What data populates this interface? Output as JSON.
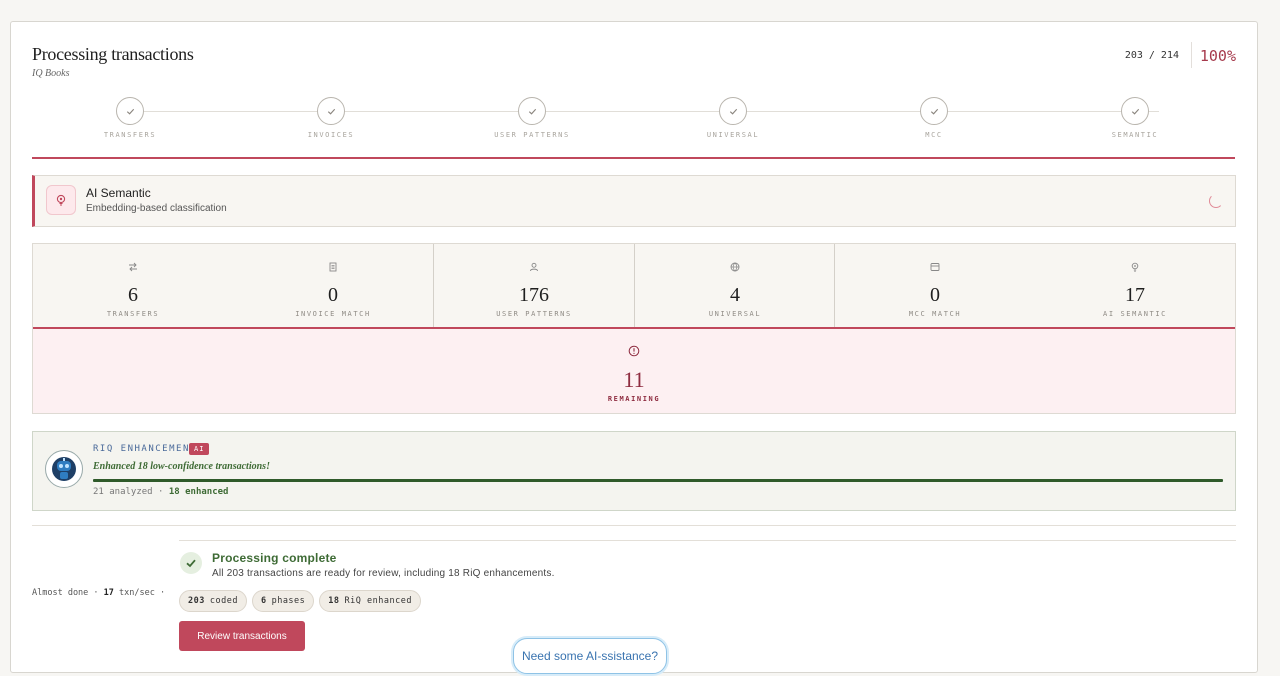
{
  "header": {
    "title": "Processing transactions",
    "subtitle": "IQ Books",
    "progress_count": "203 / 214",
    "progress_percent": "100%"
  },
  "steps": [
    {
      "label": "TRANSFERS",
      "done": true
    },
    {
      "label": "INVOICES",
      "done": true
    },
    {
      "label": "USER PATTERNS",
      "done": true
    },
    {
      "label": "UNIVERSAL",
      "done": true
    },
    {
      "label": "MCC",
      "done": true
    },
    {
      "label": "SEMANTIC",
      "done": true
    }
  ],
  "phase": {
    "title": "AI Semantic",
    "description": "Embedding-based classification",
    "icon": "bulb-icon"
  },
  "stats": [
    {
      "value": "6",
      "label": "TRANSFERS",
      "icon": "transfer-arrows-icon"
    },
    {
      "value": "0",
      "label": "INVOICE MATCH",
      "icon": "document-icon"
    },
    {
      "value": "176",
      "label": "USER PATTERNS",
      "icon": "user-icon"
    },
    {
      "value": "4",
      "label": "UNIVERSAL",
      "icon": "globe-icon"
    },
    {
      "value": "0",
      "label": "MCC MATCH",
      "icon": "card-icon"
    },
    {
      "value": "17",
      "label": "AI SEMANTIC",
      "icon": "bulb-icon"
    }
  ],
  "remaining": {
    "value": "11",
    "label": "REMAINING",
    "icon": "alert-circle-icon"
  },
  "riq": {
    "heading": "RIQ ENHANCEMENT",
    "badge": "AI",
    "message": "Enhanced 18 low-confidence transactions!",
    "analyzed": "21 analyzed",
    "dot": "·",
    "enhanced": "18 enhanced",
    "progress": 1.0
  },
  "status": {
    "label": "Almost done",
    "dot": "·",
    "rate_value": "17",
    "rate_unit": "txn/sec",
    "trail": "·"
  },
  "complete": {
    "title": "Processing complete",
    "description": "All 203 transactions are ready for review, including 18 RiQ enhancements.",
    "chips": [
      {
        "num": "203",
        "text": "coded"
      },
      {
        "num": "6",
        "text": "phases"
      },
      {
        "num": "18",
        "text": "RiQ enhanced"
      }
    ],
    "button": "Review transactions"
  },
  "assistant": {
    "label": "Need some AI-ssistance?"
  },
  "colors": {
    "accent": "#c0485c",
    "success": "#3e6b35",
    "link": "#3a74b0"
  }
}
